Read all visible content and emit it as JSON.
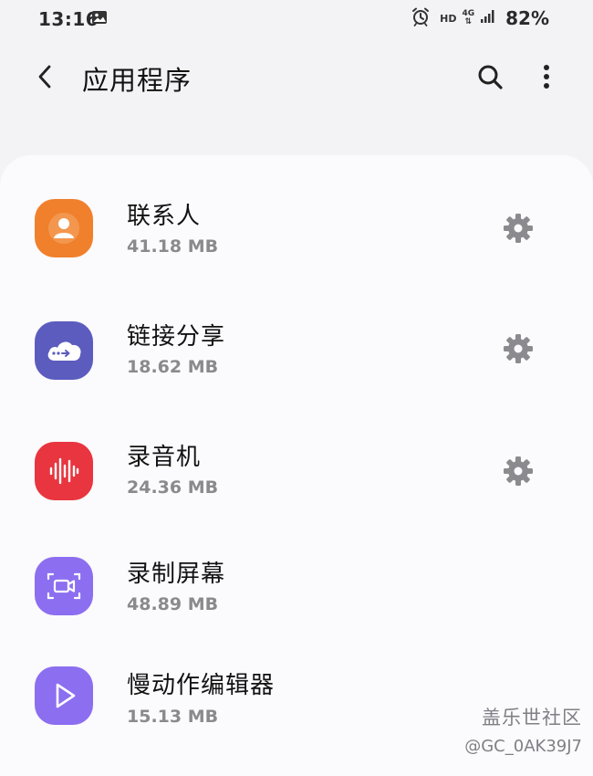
{
  "status_bar": {
    "time": "13:16",
    "network_hd": "HD",
    "network_type": "4G",
    "battery": "82%"
  },
  "header": {
    "title": "应用程序"
  },
  "apps": [
    {
      "name": "联系人",
      "size": "41.18 MB",
      "icon": "contacts-icon",
      "color": "#f0802c",
      "has_settings": true
    },
    {
      "name": "链接分享",
      "size": "18.62 MB",
      "icon": "link-share-cloud-icon",
      "color": "#5c5cbf",
      "has_settings": true
    },
    {
      "name": "录音机",
      "size": "24.36 MB",
      "icon": "voice-recorder-icon",
      "color": "#e8353f",
      "has_settings": true
    },
    {
      "name": "录制屏幕",
      "size": "48.89 MB",
      "icon": "screen-recorder-icon",
      "color": "#8c6ef0",
      "has_settings": false
    },
    {
      "name": "慢动作编辑器",
      "size": "15.13 MB",
      "icon": "slow-motion-play-icon",
      "color": "#8c6ef0",
      "has_settings": false
    }
  ],
  "watermark": {
    "title": "盖乐世社区",
    "user": "@GC_0AK39J7"
  }
}
